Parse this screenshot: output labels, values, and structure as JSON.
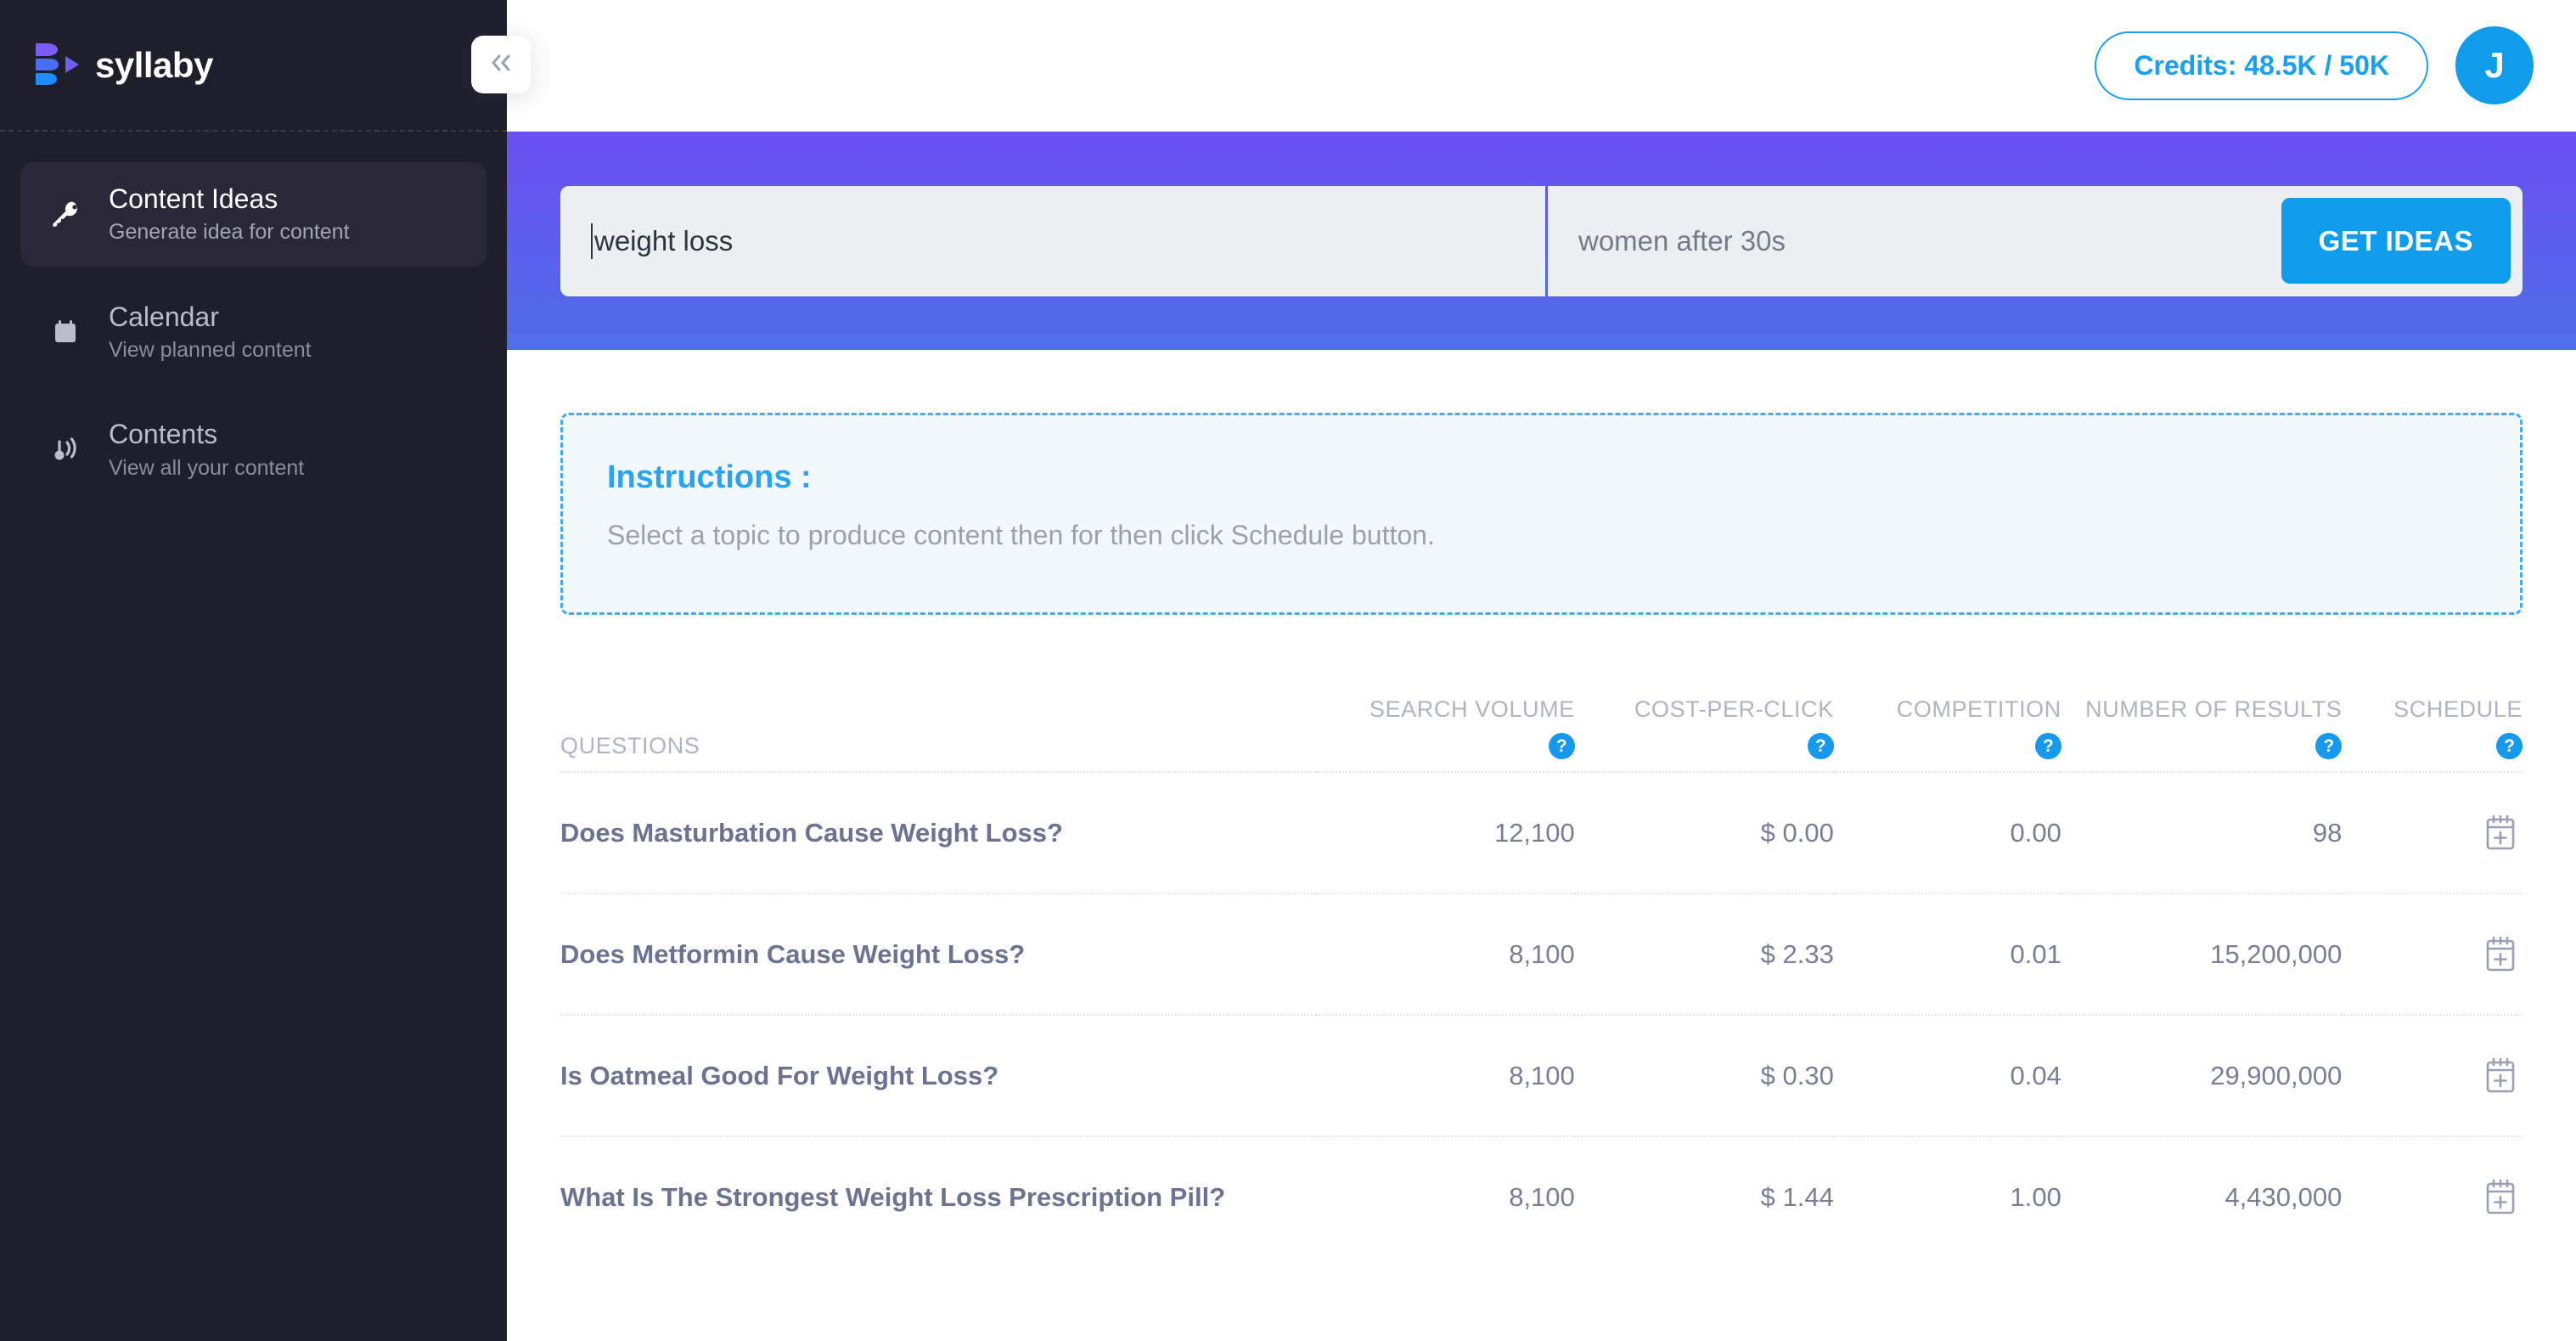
{
  "sidebar": {
    "logo_text": "syllaby",
    "collapse_label": "«",
    "items": [
      {
        "title": "Content Ideas",
        "subtitle": "Generate idea for content",
        "icon": "key-icon",
        "active": true
      },
      {
        "title": "Calendar",
        "subtitle": "View planned content",
        "icon": "calendar-icon",
        "active": false
      },
      {
        "title": "Contents",
        "subtitle": "View all your content",
        "icon": "broadcast-icon",
        "active": false
      }
    ]
  },
  "topbar": {
    "credits_label": "Credits: 48.5K / 50K",
    "avatar_initial": "J"
  },
  "search": {
    "keyword_value": "weight loss",
    "keyword_placeholder": "weight loss",
    "audience_value": "women after 30s",
    "audience_placeholder": "women after 30s",
    "submit_label": "GET IDEAS"
  },
  "instructions": {
    "title": "Instructions :",
    "body": "Select a topic to produce content then for then click Schedule button."
  },
  "table": {
    "columns": [
      {
        "key": "questions",
        "label": "QUESTIONS",
        "help": false
      },
      {
        "key": "search_volume",
        "label": "SEARCH VOLUME",
        "help": true,
        "help_glyph": "?"
      },
      {
        "key": "cost_per_click",
        "label": "COST-PER-CLICK",
        "help": true,
        "help_glyph": "?"
      },
      {
        "key": "competition",
        "label": "COMPETITION",
        "help": true,
        "help_glyph": "?"
      },
      {
        "key": "number_of_results",
        "label": "NUMBER OF RESULTS",
        "help": true,
        "help_glyph": "?"
      },
      {
        "key": "schedule",
        "label": "SCHEDULE",
        "help": true,
        "help_glyph": "?"
      }
    ],
    "rows": [
      {
        "question": "Does Masturbation Cause Weight Loss?",
        "search_volume": "12,100",
        "cost_per_click": "$ 0.00",
        "competition": "0.00",
        "number_of_results": "98",
        "schedule_icon": "calendar-plus-icon"
      },
      {
        "question": "Does Metformin Cause Weight Loss?",
        "search_volume": "8,100",
        "cost_per_click": "$ 2.33",
        "competition": "0.01",
        "number_of_results": "15,200,000",
        "schedule_icon": "calendar-plus-icon"
      },
      {
        "question": "Is Oatmeal Good For Weight Loss?",
        "search_volume": "8,100",
        "cost_per_click": "$ 0.30",
        "competition": "0.04",
        "number_of_results": "29,900,000",
        "schedule_icon": "calendar-plus-icon"
      },
      {
        "question": "What Is The Strongest Weight Loss Prescription Pill?",
        "search_volume": "8,100",
        "cost_per_click": "$ 1.44",
        "competition": "1.00",
        "number_of_results": "4,430,000",
        "schedule_icon": "calendar-plus-icon"
      }
    ]
  },
  "colors": {
    "sidebar_bg": "#1f1f2c",
    "sidebar_active_bg": "#2a2838",
    "band_gradient_start": "#6b4ef1",
    "band_gradient_end": "#4e6ee8",
    "accent_blue": "#0f9ced",
    "help_blue": "#1499ef",
    "instructions_border": "#4aa8ef",
    "instructions_bg": "#f2f9fe",
    "text_muted": "#b0b3c2",
    "text_row": "#787e95"
  }
}
